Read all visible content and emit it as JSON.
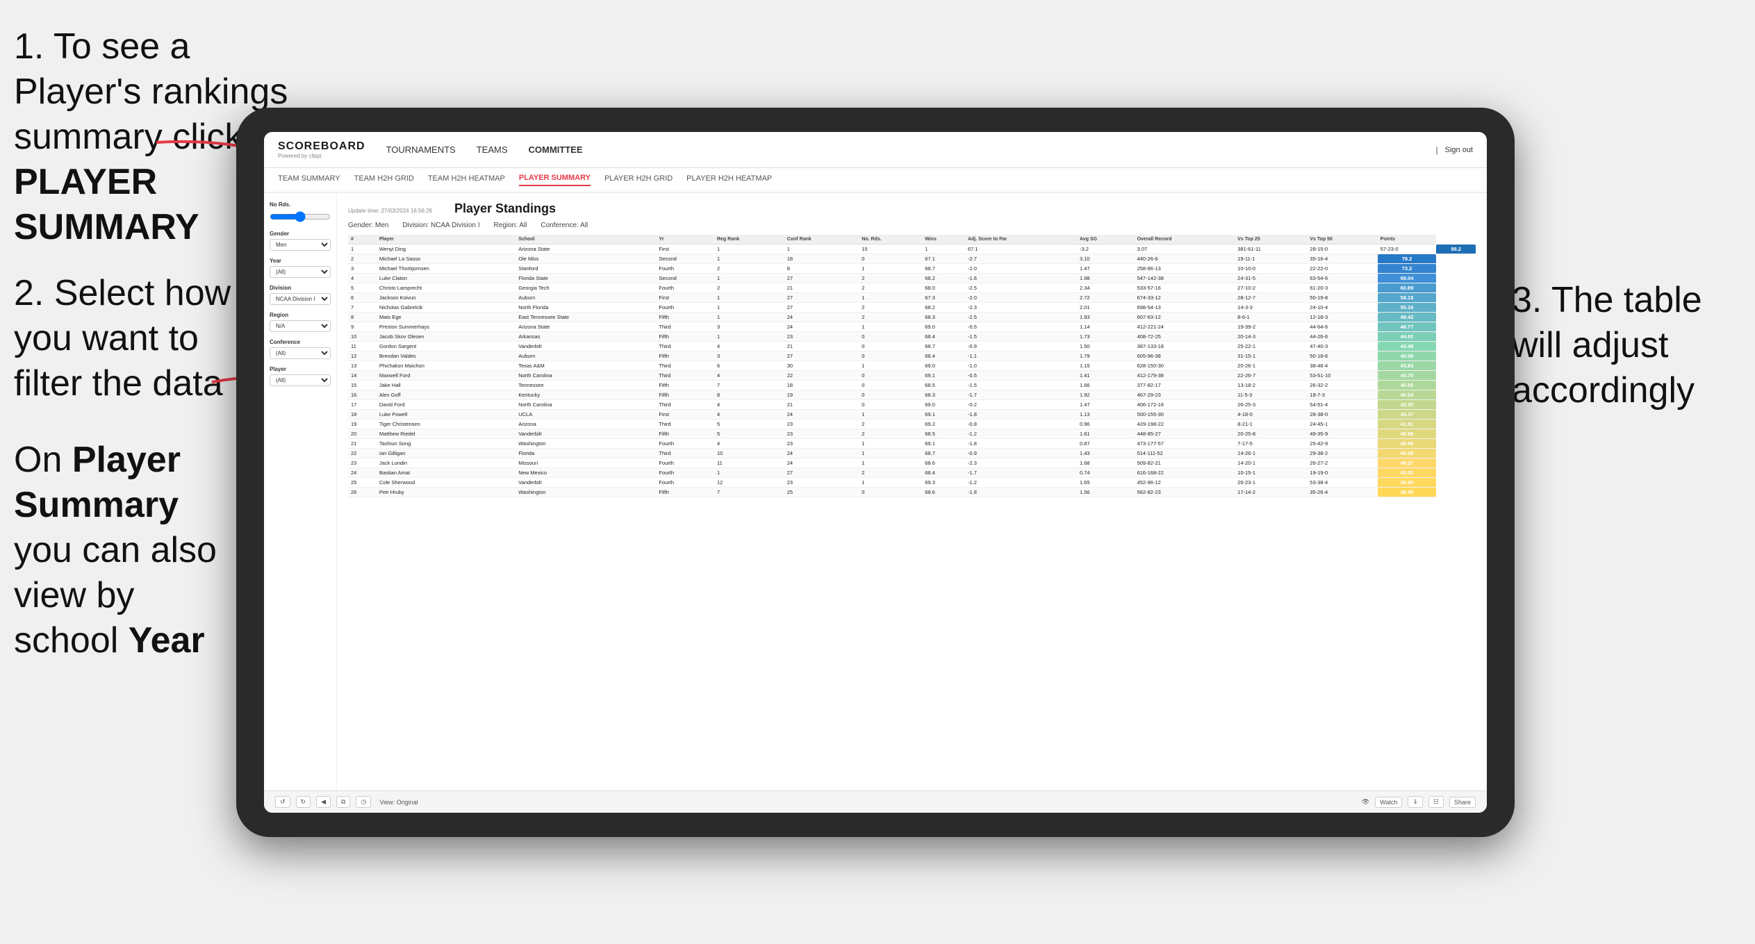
{
  "instructions": {
    "step1": "1. To see a Player's rankings summary click ",
    "step1_bold": "PLAYER SUMMARY",
    "step2_line1": "2. Select how you want to",
    "step2_line2": "filter the data",
    "step2_line3": "",
    "step_bottom_pre": "On ",
    "step_bottom_bold1": "Player Summary",
    "step_bottom_mid": " you can also view by school ",
    "step_bottom_bold2": "Year",
    "step3": "3. The table will adjust accordingly"
  },
  "nav": {
    "logo": "SCOREBOARD",
    "logo_sub": "Powered by clippi",
    "links": [
      "TOURNAMENTS",
      "TEAMS",
      "COMMITTEE"
    ],
    "sign_out": "Sign out"
  },
  "sub_nav": {
    "links": [
      "TEAM SUMMARY",
      "TEAM H2H GRID",
      "TEAM H2H HEATMAP",
      "PLAYER SUMMARY",
      "PLAYER H2H GRID",
      "PLAYER H2H HEATMAP"
    ],
    "active": "PLAYER SUMMARY"
  },
  "sidebar": {
    "no_rds_label": "No Rds.",
    "gender_label": "Gender",
    "gender_value": "Men",
    "year_label": "Year",
    "year_value": "(All)",
    "division_label": "Division",
    "division_value": "NCAA Division I",
    "region_label": "Region",
    "region_value": "N/A",
    "conference_label": "Conference",
    "conference_value": "(All)",
    "player_label": "Player",
    "player_value": "(All)"
  },
  "table": {
    "title": "Player Standings",
    "update_time": "Update time: 27/03/2024 16:56:26",
    "filters": {
      "gender": "Gender: Men",
      "division": "Division: NCAA Division I",
      "region": "Region: All",
      "conference": "Conference: All"
    },
    "columns": [
      "#",
      "Player",
      "School",
      "Yr",
      "Reg Rank",
      "Conf Rank",
      "No. Rds.",
      "Wins",
      "Adj. Score to Par",
      "Avg SG",
      "Overall Record",
      "Vs Top 25",
      "Vs Top 50",
      "Points"
    ],
    "rows": [
      [
        "1",
        "Wenyi Ding",
        "Arizona State",
        "First",
        "1",
        "1",
        "15",
        "1",
        "67.1",
        "-3.2",
        "3.07",
        "381-61-11",
        "28-15-0",
        "57-23-0",
        "88.2"
      ],
      [
        "2",
        "Michael La Sasso",
        "Ole Miss",
        "Second",
        "1",
        "18",
        "0",
        "67.1",
        "-2.7",
        "3.10",
        "440-26-6",
        "19-11-1",
        "35-16-4",
        "78.2"
      ],
      [
        "3",
        "Michael Thorbjornsen",
        "Stanford",
        "Fourth",
        "2",
        "8",
        "1",
        "68.7",
        "-2.0",
        "1.47",
        "258-86-13",
        "10-10-0",
        "22-22-0",
        "73.2"
      ],
      [
        "4",
        "Luke Claton",
        "Florida State",
        "Second",
        "1",
        "27",
        "2",
        "68.2",
        "-1.6",
        "1.98",
        "547-142-38",
        "24-31-5",
        "63-54-6",
        "68.04"
      ],
      [
        "5",
        "Christo Lamprecht",
        "Georgia Tech",
        "Fourth",
        "2",
        "21",
        "2",
        "68.0",
        "-2.5",
        "2.34",
        "533-57-16",
        "27-10-2",
        "61-20-3",
        "60.89"
      ],
      [
        "6",
        "Jackson Koivun",
        "Auburn",
        "First",
        "1",
        "27",
        "1",
        "67.3",
        "-2.0",
        "2.72",
        "674-33-12",
        "28-12-7",
        "50-19-8",
        "58.18"
      ],
      [
        "7",
        "Nicholas Gabrelcik",
        "North Florida",
        "Fourth",
        "1",
        "27",
        "2",
        "68.2",
        "-2.3",
        "2.01",
        "698-54-13",
        "14-3-3",
        "24-10-4",
        "55.16"
      ],
      [
        "8",
        "Mats Ege",
        "East Tennessee State",
        "Fifth",
        "1",
        "24",
        "2",
        "68.3",
        "-2.5",
        "1.93",
        "607-63-12",
        "8-6-1",
        "12-18-3",
        "49.42"
      ],
      [
        "9",
        "Preston Summerhays",
        "Arizona State",
        "Third",
        "3",
        "24",
        "1",
        "69.0",
        "-0.5",
        "1.14",
        "412-221-24",
        "19-39-2",
        "44-64-6",
        "46.77"
      ],
      [
        "10",
        "Jacob Skov Olesen",
        "Arkansas",
        "Fifth",
        "1",
        "23",
        "0",
        "68.4",
        "-1.5",
        "1.73",
        "408-72-25",
        "20-14-3",
        "44-26-6",
        "44.92"
      ],
      [
        "11",
        "Gordon Sargent",
        "Vanderbilt",
        "Third",
        "4",
        "21",
        "0",
        "68.7",
        "-0.9",
        "1.50",
        "387-133-18",
        "25-22-1",
        "47-40-3",
        "43.49"
      ],
      [
        "12",
        "Brendan Valdes",
        "Auburn",
        "Fifth",
        "3",
        "27",
        "0",
        "68.4",
        "-1.1",
        "1.79",
        "605-96-38",
        "31-15-1",
        "50-18-6",
        "40.96"
      ],
      [
        "13",
        "Phichaksn Maichon",
        "Texas A&M",
        "Third",
        "6",
        "30",
        "1",
        "69.0",
        "-1.0",
        "1.15",
        "628-150-30",
        "20-26-1",
        "38-46-4",
        "43.83"
      ],
      [
        "14",
        "Maxwell Ford",
        "North Carolina",
        "Third",
        "4",
        "22",
        "0",
        "69.1",
        "-0.5",
        "1.41",
        "412-179-38",
        "22-26-7",
        "53-51-10",
        "40.75"
      ],
      [
        "15",
        "Jake Hall",
        "Tennessee",
        "Fifth",
        "7",
        "18",
        "0",
        "68.5",
        "-1.5",
        "1.66",
        "377-82-17",
        "13-18-2",
        "26-32-2",
        "40.55"
      ],
      [
        "16",
        "Alex Goff",
        "Kentucky",
        "Fifth",
        "8",
        "19",
        "0",
        "68.3",
        "-1.7",
        "1.92",
        "467-29-23",
        "11-5-3",
        "18-7-3",
        "40.54"
      ],
      [
        "17",
        "David Ford",
        "North Carolina",
        "Third",
        "4",
        "21",
        "0",
        "69.0",
        "-0.2",
        "1.47",
        "406-172-16",
        "26-25-3",
        "54-51-4",
        "42.35"
      ],
      [
        "18",
        "Luke Powell",
        "UCLA",
        "First",
        "4",
        "24",
        "1",
        "69.1",
        "-1.8",
        "1.13",
        "500-155-30",
        "4-18-0",
        "28-38-0",
        "43.47"
      ],
      [
        "19",
        "Tiger Christensen",
        "Arizona",
        "Third",
        "5",
        "23",
        "2",
        "69.2",
        "-0.8",
        "0.96",
        "429-198-22",
        "8-21-1",
        "24-45-1",
        "41.81"
      ],
      [
        "20",
        "Matthew Riedel",
        "Vanderbilt",
        "Fifth",
        "5",
        "23",
        "2",
        "68.5",
        "-1.2",
        "1.61",
        "448-85-27",
        "20-25-8",
        "49-35-9",
        "40.98"
      ],
      [
        "21",
        "Tashiun Song",
        "Washington",
        "Fourth",
        "4",
        "23",
        "1",
        "69.1",
        "-1.8",
        "0.87",
        "473-177-57",
        "7-17-5",
        "25-42-9",
        "40.98"
      ],
      [
        "22",
        "Ian Gilligan",
        "Florida",
        "Third",
        "10",
        "24",
        "1",
        "68.7",
        "-0.9",
        "1.43",
        "514-111-52",
        "14-26-1",
        "29-38-2",
        "40.69"
      ],
      [
        "23",
        "Jack Lundin",
        "Missouri",
        "Fourth",
        "11",
        "24",
        "1",
        "68.6",
        "-2.3",
        "1.68",
        "509-82-21",
        "14-20-1",
        "26-27-2",
        "40.27"
      ],
      [
        "24",
        "Bastian Amat",
        "New Mexico",
        "Fourth",
        "1",
        "27",
        "2",
        "68.4",
        "-1.7",
        "0.74",
        "616-168-22",
        "10-15-1",
        "19-19-0",
        "40.02"
      ],
      [
        "25",
        "Cole Sherwood",
        "Vanderbilt",
        "Fourth",
        "12",
        "23",
        "1",
        "69.3",
        "-1.2",
        "1.65",
        "452-96-12",
        "26-23-1",
        "53-38-4",
        "39.95"
      ],
      [
        "26",
        "Petr Hruby",
        "Washington",
        "Fifth",
        "7",
        "25",
        "0",
        "68.6",
        "-1.8",
        "1.56",
        "562-82-23",
        "17-14-2",
        "35-26-4",
        "39.45"
      ]
    ]
  },
  "toolbar": {
    "view_label": "View: Original",
    "watch_label": "Watch",
    "share_label": "Share"
  }
}
